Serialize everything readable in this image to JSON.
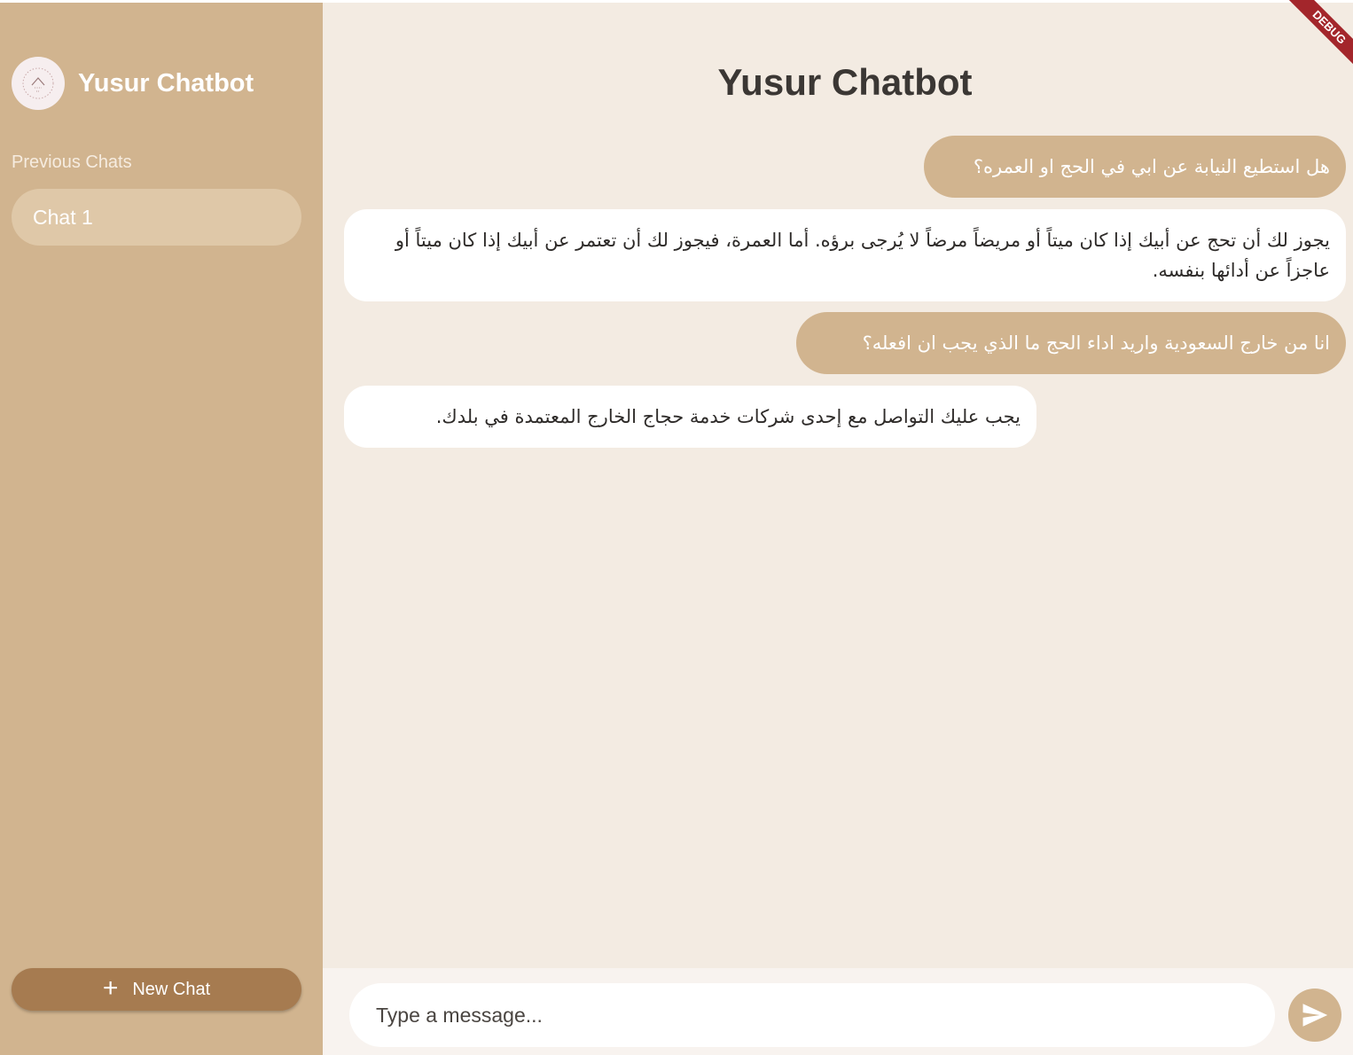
{
  "app": {
    "name": "Yusur Chatbot",
    "debug_banner": "DEBUG"
  },
  "sidebar": {
    "brand_name": "Yusur Chatbot",
    "avatar_icon": "yusur-logo-icon",
    "section_label": "Previous Chats",
    "chats": [
      {
        "label": "Chat 1"
      }
    ],
    "new_chat_label": "New Chat",
    "new_chat_icon": "plus-icon"
  },
  "main": {
    "title": "Yusur Chatbot",
    "messages": [
      {
        "role": "user",
        "text": "هل استطيع النيابة عن ابي في الحج او العمره؟"
      },
      {
        "role": "bot",
        "text": "يجوز لك أن تحج عن أبيك إذا كان ميتاً أو مريضاً مرضاً لا يُرجى برؤه. أما العمرة، فيجوز لك أن تعتمر عن أبيك إذا كان ميتاً أو عاجزاً عن أدائها بنفسه."
      },
      {
        "role": "user",
        "text": "انا من خارج السعودية واريد اداء الحج ما الذي يجب ان افعله؟"
      },
      {
        "role": "bot",
        "text": "يجب عليك التواصل مع إحدى شركات خدمة حجاج الخارج المعتمدة في بلدك."
      }
    ]
  },
  "composer": {
    "placeholder": "Type a message...",
    "value": "",
    "send_icon": "send-icon"
  },
  "colors": {
    "sidebar": "#d1b48f",
    "chat_item": "#dfc8a8",
    "new_chat_button": "#a67b50",
    "main_background": "#f3ebe2",
    "user_bubble": "#d1b48f",
    "bot_bubble": "#ffffff",
    "debug_banner": "#a3262b"
  }
}
